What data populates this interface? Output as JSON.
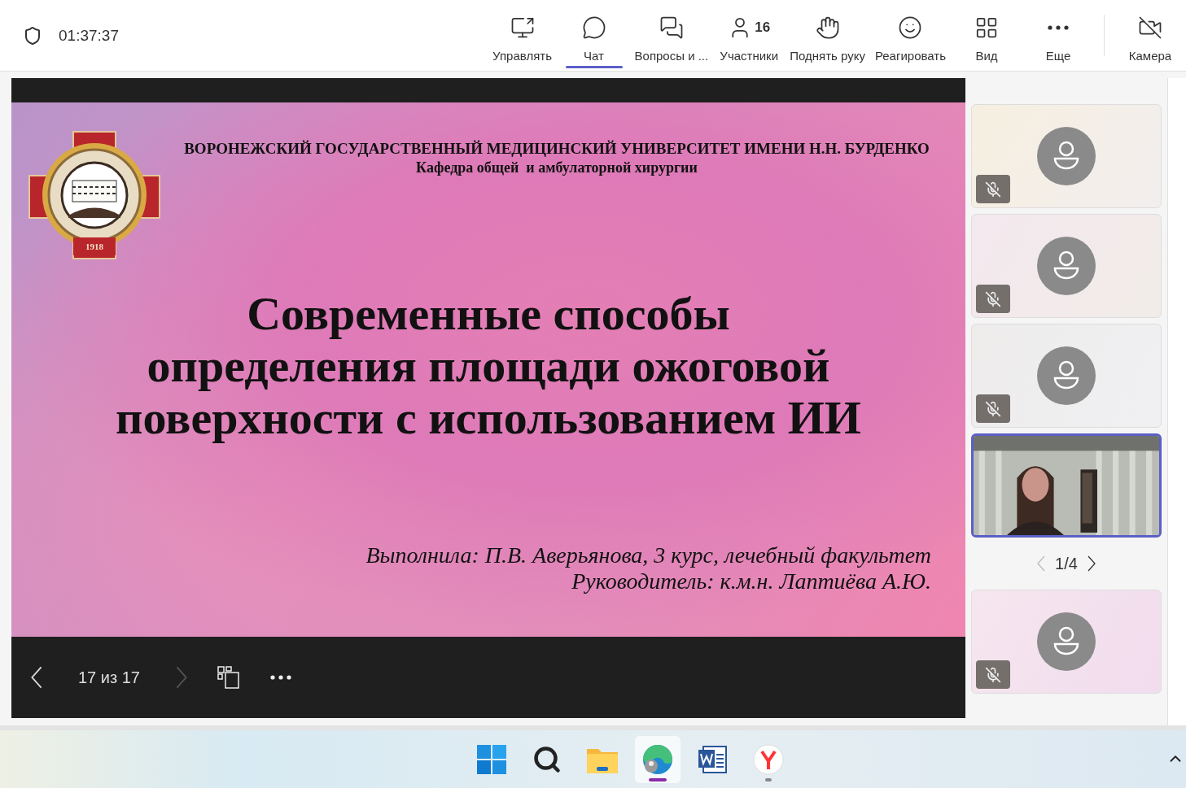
{
  "call": {
    "timer": "01:37:37"
  },
  "toolbar": [
    {
      "label": "Управлять",
      "selected": false
    },
    {
      "label": "Чат",
      "selected": true
    },
    {
      "label": "Вопросы и ...",
      "selected": false
    },
    {
      "label": "Участники",
      "count": "16",
      "selected": false
    },
    {
      "label": "Поднять руку",
      "selected": false
    },
    {
      "label": "Реагировать",
      "selected": false
    },
    {
      "label": "Вид",
      "selected": false
    },
    {
      "label": "Еще",
      "selected": false
    },
    {
      "label": "Камера",
      "selected": false
    }
  ],
  "slide": {
    "logo_year": "1918",
    "university": "ВОРОНЕЖСКИЙ ГОСУДАРСТВЕННЫЙ МЕДИЦИНСКИЙ УНИВЕРСИТЕТ ИМЕНИ Н.Н. БУРДЕНКО",
    "department": "Кафедра общей  и амбулаторной хирургии",
    "title": "Современные способы определения площади ожоговой поверхности с использованием ИИ",
    "credits": [
      "Выполнила: П.В. Аверьянова, 3 курс, лечебный факультет",
      "Руководитель: к.м.н. Лаптиёва А.Ю."
    ]
  },
  "slide_controls": {
    "counter": "17 из 17",
    "prev_disabled": false,
    "next_disabled": true
  },
  "participants": [
    {
      "kind": "avatar",
      "muted": true,
      "selected": false
    },
    {
      "kind": "avatar",
      "muted": true,
      "selected": false
    },
    {
      "kind": "avatar",
      "muted": true,
      "selected": false
    },
    {
      "kind": "video",
      "muted": false,
      "selected": true
    },
    {
      "kind": "avatar",
      "muted": true,
      "selected": false
    }
  ],
  "pager": {
    "label": "1/4",
    "prev_disabled": true,
    "next_disabled": false
  },
  "taskbar": [
    {
      "kind": "start",
      "active": false,
      "running": false
    },
    {
      "kind": "search",
      "active": false,
      "running": false
    },
    {
      "kind": "files",
      "active": false,
      "running": false
    },
    {
      "kind": "edge",
      "active": true,
      "running": true
    },
    {
      "kind": "word",
      "active": false,
      "running": false
    },
    {
      "kind": "yandex",
      "active": false,
      "running": true
    }
  ]
}
